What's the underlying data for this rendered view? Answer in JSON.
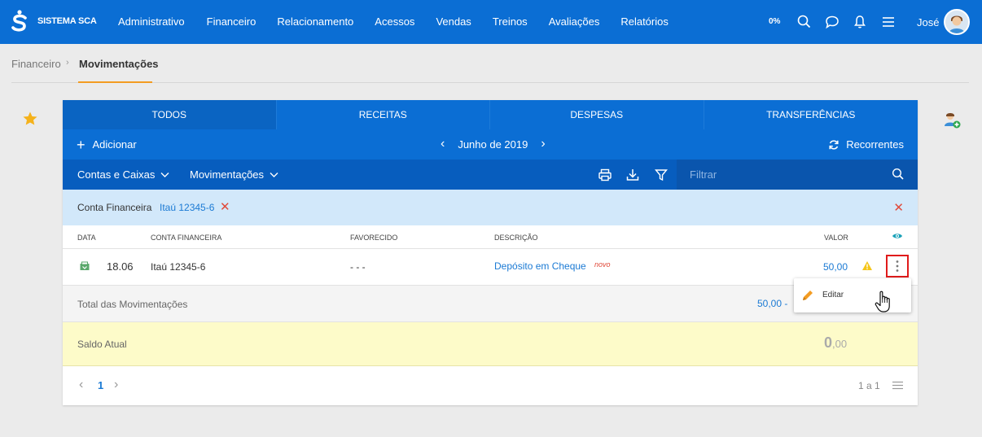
{
  "header": {
    "brand": "SISTEMA SCA",
    "nav": [
      "Administrativo",
      "Financeiro",
      "Relacionamento",
      "Acessos",
      "Vendas",
      "Treinos",
      "Avaliações",
      "Relatórios"
    ],
    "progress": "0%",
    "user": "José",
    "icons": [
      "search-icon",
      "chat-icon",
      "bell-icon",
      "menu-icon"
    ]
  },
  "breadcrumb": {
    "parent": "Financeiro",
    "current": "Movimentações"
  },
  "tabs": [
    "TODOS",
    "RECEITAS",
    "DESPESAS",
    "TRANSFERÊNCIAS"
  ],
  "toolbar": {
    "add_label": "Adicionar",
    "month": "Junho de 2019",
    "recurring_label": "Recorrentes",
    "accounts_dropdown": "Contas e Caixas",
    "movements_dropdown": "Movimentações",
    "filter_placeholder": "Filtrar"
  },
  "active_filter": {
    "label": "Conta Financeira",
    "value": "Itaú 12345-6"
  },
  "table": {
    "columns": [
      "DATA",
      "CONTA FINANCEIRA",
      "FAVORECIDO",
      "DESCRIÇÃO",
      "VALOR"
    ],
    "rows": [
      {
        "date": "18.06",
        "account": "Itaú 12345-6",
        "payee": "- - -",
        "description": "Depósito em Cheque",
        "badge": "novo",
        "value": "50,00"
      }
    ],
    "total_label": "Total das Movimentações",
    "total_value": "50,00 -",
    "balance_label": "Saldo Atual",
    "balance_int": "0",
    "balance_dec": ",00"
  },
  "pagination": {
    "current_page": "1",
    "range": "1 a 1"
  },
  "context_menu": {
    "edit_label": "Editar"
  },
  "colors": {
    "primary": "#0b6ed4",
    "accent": "#f39c22",
    "danger": "#e04a3a",
    "link": "#1b7ad4"
  }
}
